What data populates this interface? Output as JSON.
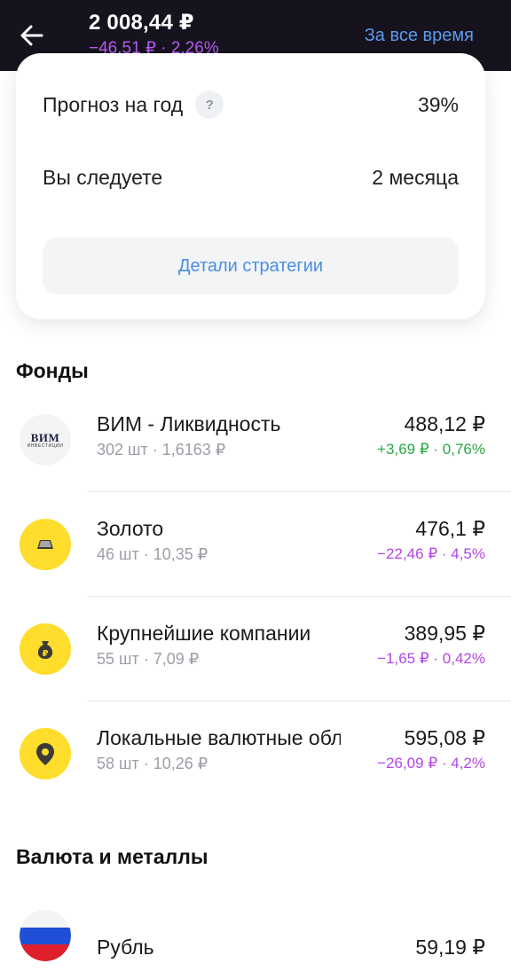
{
  "header": {
    "value": "2 008,44 ₽",
    "change": "−46,51 ₽ · 2,26%",
    "period": "За все время"
  },
  "strategy": {
    "forecast_label": "Прогноз на год",
    "forecast_help": "?",
    "forecast_value": "39%",
    "follow_label": "Вы следуете",
    "follow_value": "2 месяца",
    "details_button": "Детали стратегии"
  },
  "sections": {
    "funds_title": "Фонды",
    "currency_title": "Валюта и металлы"
  },
  "funds": [
    {
      "name": "ВИМ - Ликвидность",
      "sub": "302 шт · 1,6163 ₽",
      "price": "488,12 ₽",
      "change": "+3,69 ₽ · 0,76%",
      "direction": "positive",
      "icon": "vim-logo",
      "logo_main": "ВИМ",
      "logo_sub": "ИНВЕСТИЦИИ"
    },
    {
      "name": "Золото",
      "sub": "46 шт · 10,35 ₽",
      "price": "476,1 ₽",
      "change": "−22,46 ₽ · 4,5%",
      "direction": "negative",
      "icon": "gold-bar-icon"
    },
    {
      "name": "Крупнейшие компании",
      "sub": "55 шт · 7,09 ₽",
      "price": "389,95 ₽",
      "change": "−1,65 ₽ · 0,42%",
      "direction": "negative",
      "icon": "money-bag-icon"
    },
    {
      "name": "Локальные валютные облигации",
      "sub": "58 шт · 10,26 ₽",
      "price": "595,08 ₽",
      "change": "−26,09 ₽ · 4,2%",
      "direction": "negative",
      "icon": "map-pin-icon"
    }
  ],
  "currency": [
    {
      "name": "Рубль",
      "price": "59,19 ₽",
      "icon": "russia-flag-icon"
    }
  ],
  "colors": {
    "header_bg": "#17131e",
    "accent_blue": "#5b9bf0",
    "negative": "#b544e6",
    "positive": "#27a844",
    "icon_yellow": "#fedd2c"
  }
}
